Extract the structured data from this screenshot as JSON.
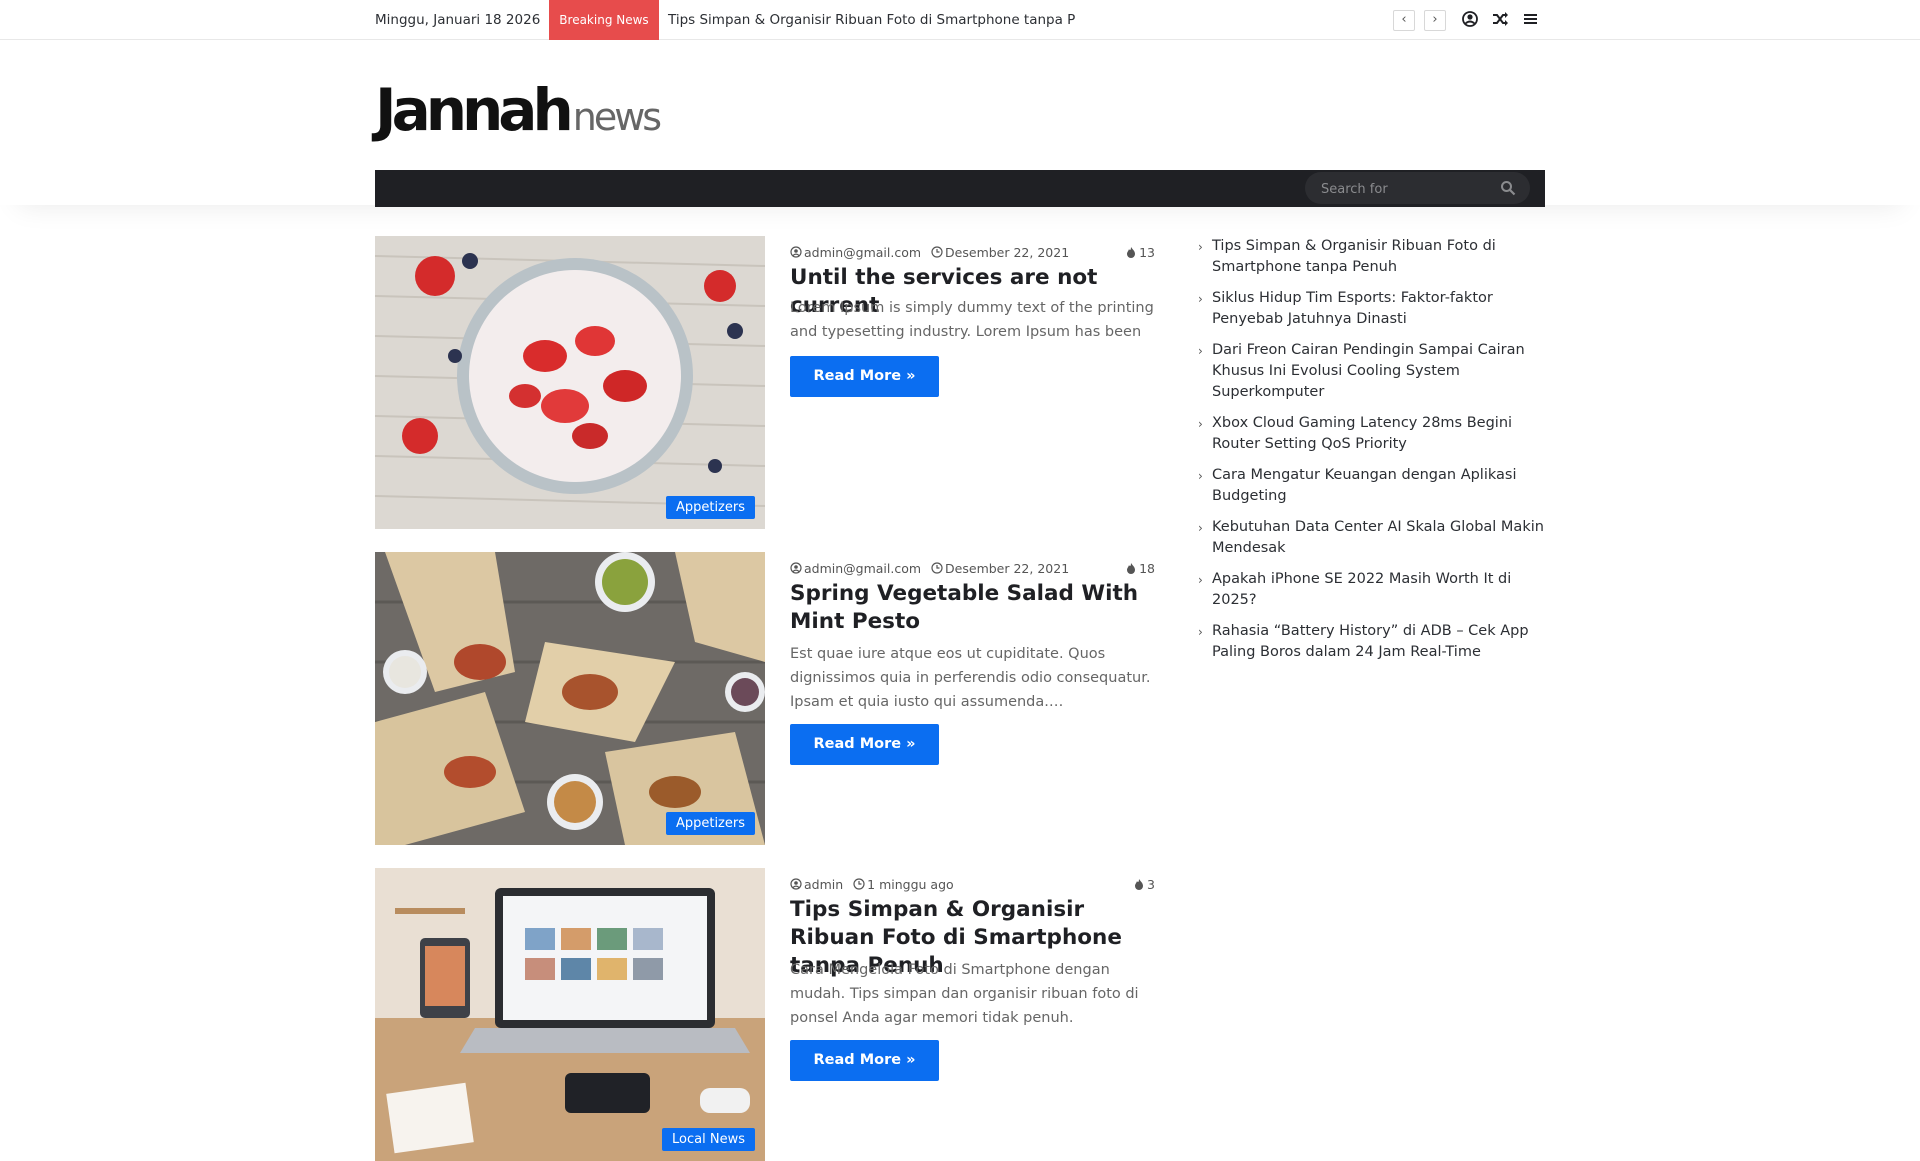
{
  "topbar": {
    "date": "Minggu, Januari 18 2026",
    "breaking_label": "Breaking News",
    "ticker_text": "Tips Simpan & Organisir Ribuan Foto di Smartphone tanpa P",
    "prev_label": "‹",
    "next_label": "›"
  },
  "header": {
    "logo_main": "Jannah",
    "logo_sub": "news"
  },
  "search": {
    "placeholder": "Search for"
  },
  "posts": [
    {
      "author": "admin@gmail.com",
      "date": "Desember 22, 2021",
      "views": "13",
      "title": "Until the services are not current",
      "excerpt": "Lorem Ipsum is simply dummy text of the printing and typesetting industry. Lorem Ipsum has been",
      "category": "Appetizers",
      "read_more": "Read More »"
    },
    {
      "author": "admin@gmail.com",
      "date": "Desember 22, 2021",
      "views": "18",
      "title": "Spring Vegetable Salad With Mint Pesto",
      "excerpt": "Est quae iure atque eos ut cupiditate. Quos dignissimos quia in perferendis odio consequatur. Ipsam et quia iusto qui assumenda.…",
      "category": "Appetizers",
      "read_more": "Read More »"
    },
    {
      "author": "admin",
      "date": "1 minggu ago",
      "views": "3",
      "title": "Tips Simpan & Organisir Ribuan Foto di Smartphone tanpa Penuh",
      "excerpt": "Cara Mengelola Foto di Smartphone dengan mudah. Tips simpan dan organisir ribuan foto di ponsel Anda agar memori tidak penuh.",
      "category": "Local News",
      "read_more": "Read More »"
    }
  ],
  "sidebar": {
    "items": [
      "Tips Simpan & Organisir Ribuan Foto di Smartphone tanpa Penuh",
      "Siklus Hidup Tim Esports: Faktor-faktor Penyebab Jatuhnya Dinasti",
      "Dari Freon Cairan Pendingin Sampai Cairan Khusus Ini Evolusi Cooling System Superkomputer",
      "Xbox Cloud Gaming Latency 28ms Begini Router Setting QoS Priority",
      "Cara Mengatur Keuangan dengan Aplikasi Budgeting",
      "Kebutuhan Data Center AI Skala Global Makin Mendesak",
      "Apakah iPhone SE 2022 Masih Worth It di 2025?",
      "Rahasia “Battery History” di ADB – Cek App Paling Boros dalam 24 Jam Real-Time"
    ]
  },
  "colors": {
    "accent": "#0b6ef1",
    "breaking": "#e74c4c",
    "menubar": "#1f2024"
  },
  "icons": [
    "user-icon",
    "random-icon",
    "menu-icon",
    "search-icon",
    "author-icon",
    "clock-icon",
    "fire-icon",
    "chevron-right-icon"
  ]
}
